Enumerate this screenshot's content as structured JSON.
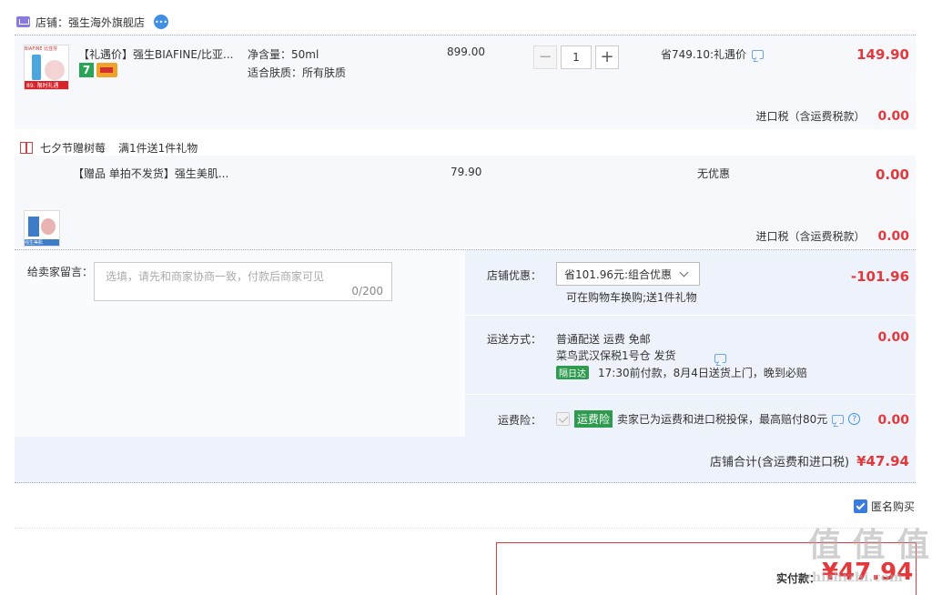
{
  "shop": {
    "label": "店铺：",
    "name": "强生海外旗舰店",
    "ww_icon": "wangwang-chat-icon"
  },
  "item1": {
    "title": "【礼遇价】强生BIAFINE/比亚...",
    "spec1": "净含量：50ml",
    "spec2": "适合肤质：所有肤质",
    "unit_price": "899.00",
    "qty": "1",
    "minus": "−",
    "plus": "+",
    "discount": "省749.10:礼遇价",
    "subtotal": "149.90",
    "badge_7": "7",
    "thumb_top": "BIAFINE 比亚芬",
    "thumb_badge": "89.",
    "thumb_bottom": "限时礼遇"
  },
  "tax1": {
    "label": "进口税（含运费税款）",
    "value": "0.00"
  },
  "gift": {
    "label": "七夕节赠树莓",
    "desc": "满1件送1件礼物"
  },
  "item2": {
    "title": "【赠品 单拍不发货】强生美肌...",
    "unit_price": "79.90",
    "discount": "无优惠",
    "subtotal": "0.00",
    "thumb_text": "强生美肌"
  },
  "tax2": {
    "label": "进口税（含运费税款）",
    "value": "0.00"
  },
  "message": {
    "label": "给卖家留言：",
    "placeholder": "选填，请先和商家协商一致，付款后商家可见",
    "counter": "0/200"
  },
  "coupon": {
    "label": "店铺优惠：",
    "selected": "省101.96元:组合优惠",
    "note": "可在购物车换购;送1件礼物",
    "value": "-101.96"
  },
  "shipping": {
    "label": "运送方式：",
    "line1": "普通配送 运费 免邮",
    "line2": "菜鸟武汉保税1号仓  发货",
    "tag": "隔日达",
    "line3": "17:30前付款，8月4日送货上门，晚到必赔",
    "value": "0.00"
  },
  "insurance": {
    "label": "运费险：",
    "tag": "运费险",
    "text": "卖家已为运费和进口税投保，最高赔付80元",
    "value": "0.00"
  },
  "shop_total": {
    "label": "店铺合计(含运费和进口税)",
    "value": "¥47.94"
  },
  "anonymous": {
    "label": "匿名购买",
    "checked": true
  },
  "pay": {
    "label": "实付款：",
    "value": "¥47.94"
  },
  "watermark": {
    "big": "值 值 值",
    "small": "zhizhizhi.com"
  },
  "colors": {
    "accent": "#e4393c",
    "row_bg": "#f6f8fc",
    "checkbox": "#3a7be0",
    "green": "#2e9b4f"
  }
}
